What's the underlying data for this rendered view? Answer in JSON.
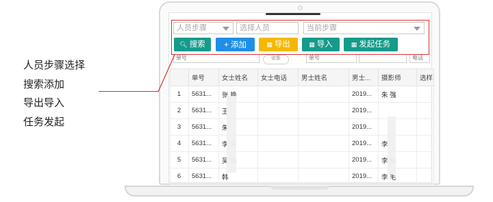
{
  "annotation": {
    "lines": [
      "人员步骤选择",
      "搜索添加",
      "导出导入",
      "任务发起"
    ]
  },
  "filters": {
    "step_placeholder": "人员步骤",
    "person_placeholder": "选择人员",
    "current_step_placeholder": "当前步骤"
  },
  "toolbar": {
    "search_label": "搜索",
    "add_label": "添加",
    "export_label": "导出",
    "import_label": "导入",
    "launch_label": "发起任务",
    "colors": {
      "teal": "#169a8a",
      "blue": "#1f8ee6",
      "yellow": "#f5b800"
    }
  },
  "filter_row": {
    "field1": "单号",
    "pill": "收集",
    "field2": "单号",
    "field3": "电话"
  },
  "table": {
    "columns": [
      "",
      "单号",
      "女士姓名",
      "女士电话",
      "男士姓名",
      "男士...",
      "摄影师",
      "选样"
    ],
    "rows": [
      [
        "1",
        "5631...",
        "张  艳",
        "",
        "",
        "2019...",
        "朱  强",
        ""
      ],
      [
        "2",
        "5631...",
        "王",
        "",
        "",
        "2019...",
        "",
        ""
      ],
      [
        "3",
        "5631...",
        "朱",
        "",
        "",
        "2019...",
        "",
        ""
      ],
      [
        "4",
        "5631...",
        "李  芳",
        "",
        "",
        "2019...",
        "李",
        ""
      ],
      [
        "5",
        "5631...",
        "吴  梅",
        "",
        "",
        "2019...",
        "李  旭",
        ""
      ],
      [
        "6",
        "5631...",
        "韩",
        "",
        "",
        "2019...",
        "李  毛",
        ""
      ]
    ]
  },
  "highlight_color": "#d93030"
}
